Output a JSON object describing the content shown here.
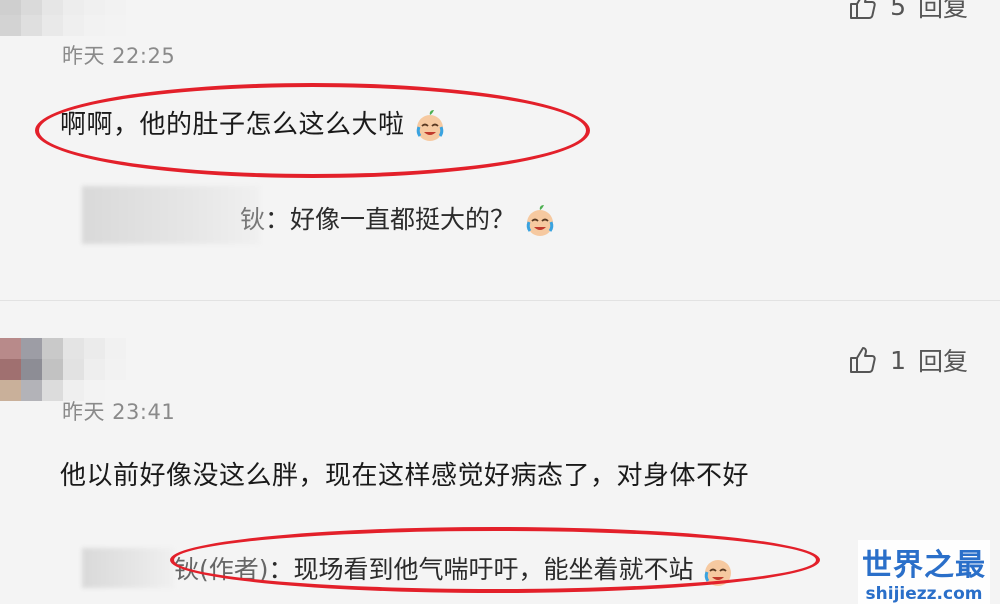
{
  "comment1": {
    "date": "昨天 22:25",
    "text": "啊啊，他的肚子怎么这么大啦",
    "likes": "5",
    "reply_label": "回复",
    "reply": {
      "name_tail": "钬",
      "text": "：好像一直都挺大的？"
    }
  },
  "comment2": {
    "date": "昨天 23:41",
    "text": "他以前好像没这么胖，现在这样感觉好病态了，对身体不好",
    "likes": "1",
    "reply_label": "回复",
    "reply": {
      "name_tail": "钬(作者)",
      "text": "：现场看到他气喘吁吁，能坐着就不站"
    }
  },
  "watermark": {
    "cn": "世界之最",
    "en": "shijiezz.com"
  },
  "colors": {
    "highlight": "#e3202a",
    "watermark": "#2a6fc9"
  },
  "icons": [
    "thumb-up-icon",
    "crying-laughing-emoji"
  ]
}
